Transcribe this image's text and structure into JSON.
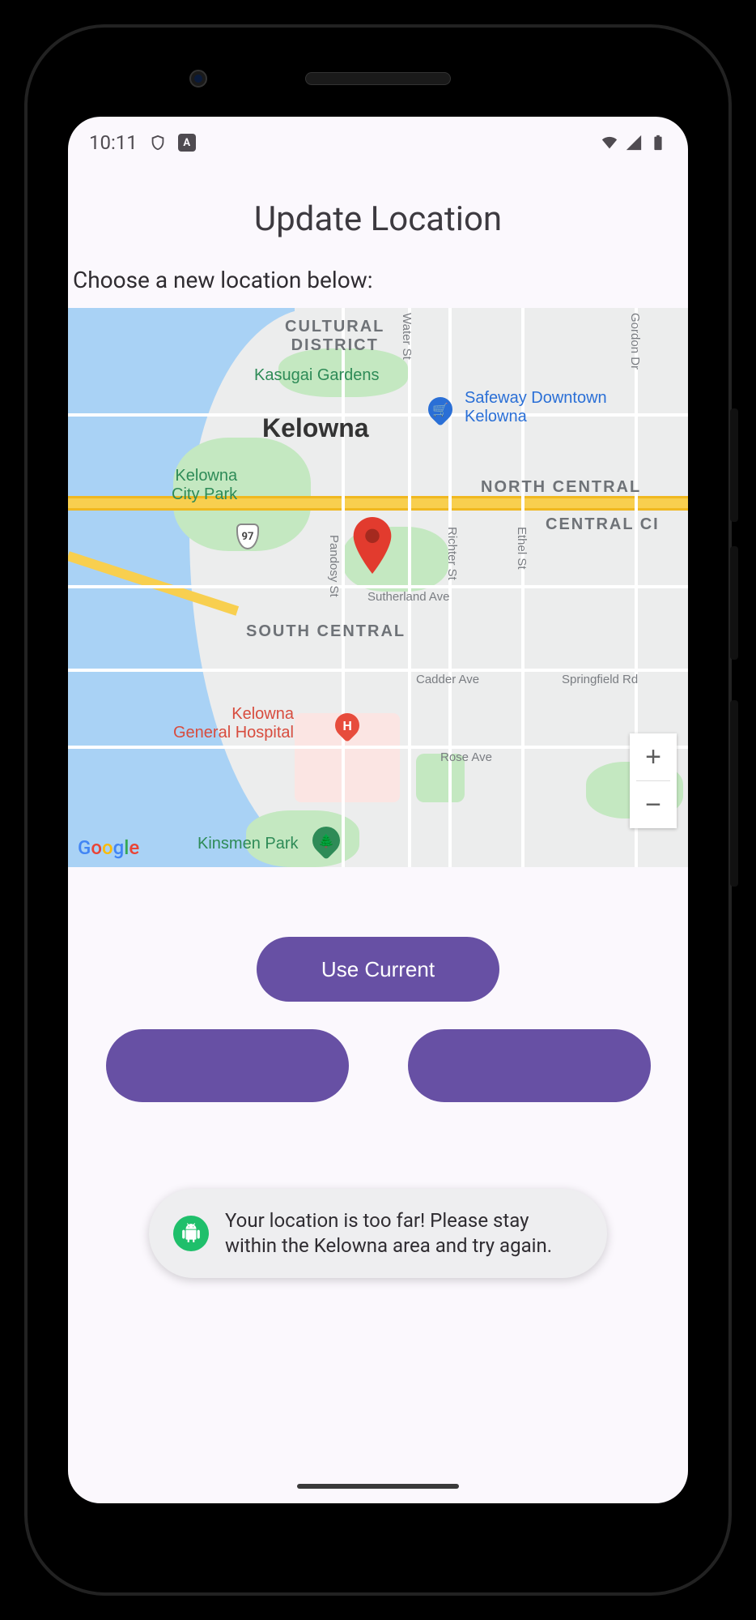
{
  "statusbar": {
    "time": "10:11",
    "keyboard_badge": "A"
  },
  "page": {
    "title": "Update Location",
    "instruction": "Choose a new location below:"
  },
  "map": {
    "city": "Kelowna",
    "areas": {
      "cultural": "CULTURAL\nDISTRICT",
      "north_central": "NORTH CENTRAL",
      "central_city": "CENTRAL CI",
      "south_central": "SOUTH CENTRAL"
    },
    "poi": {
      "kasugai": "Kasugai Gardens",
      "city_park": "Kelowna\nCity Park",
      "safeway": "Safeway Downtown\nKelowna",
      "hospital": "Kelowna\nGeneral Hospital",
      "kinsmen": "Kinsmen Park"
    },
    "streets": {
      "water": "Water St",
      "pandosy": "Pandosy St",
      "richter": "Richter St",
      "ethel": "Ethel St",
      "gordon": "Gordon Dr",
      "sutherland": "Sutherland Ave",
      "cadder": "Cadder Ave",
      "rose": "Rose Ave",
      "springfield": "Springfield Rd"
    },
    "hwy": "97",
    "attribution": "Google"
  },
  "buttons": {
    "use_current": "Use Current"
  },
  "toast": {
    "message": "Your location is too far! Please stay within the Kelowna area and try again."
  }
}
